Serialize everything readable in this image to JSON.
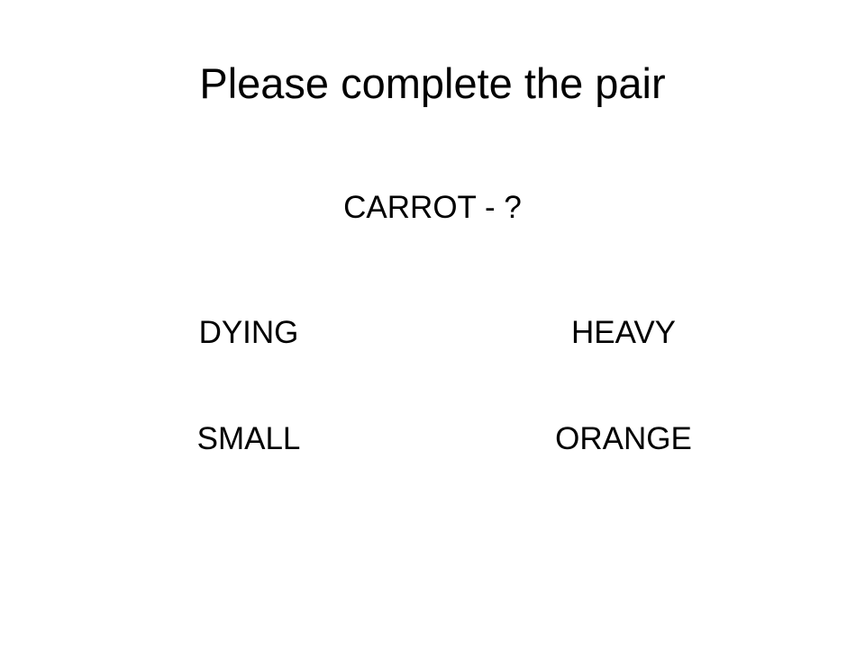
{
  "slide": {
    "title": "Please complete the pair",
    "prompt": "CARROT - ?",
    "options": [
      "DYING",
      "HEAVY",
      "SMALL",
      "ORANGE"
    ]
  }
}
